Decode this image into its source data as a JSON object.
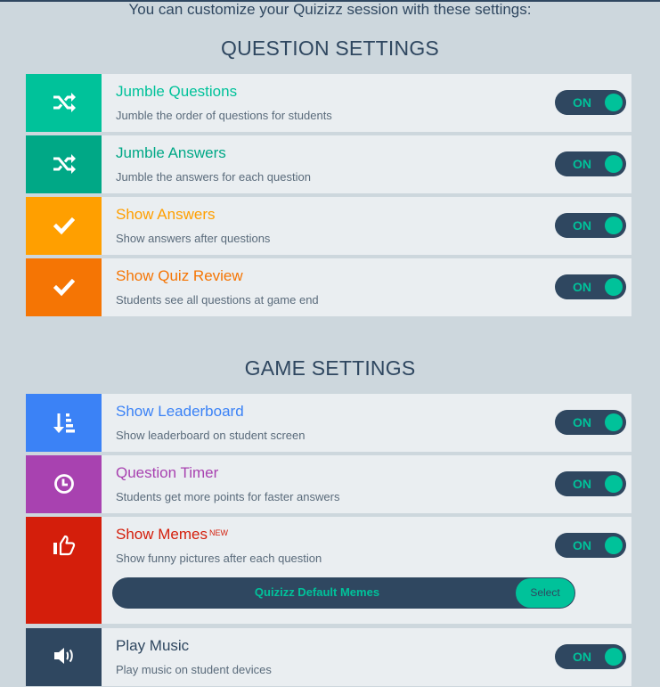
{
  "intro_text": "You can customize your Quizizz session with these settings:",
  "question_settings": {
    "heading": "QUESTION SETTINGS",
    "items": [
      {
        "title": "Jumble Questions",
        "description": "Jumble the order of questions for students",
        "icon": "shuffle-icon",
        "color": "#00c29a",
        "icon_bg": "#00c29a",
        "toggle": "ON"
      },
      {
        "title": "Jumble Answers",
        "description": "Jumble the answers for each question",
        "icon": "shuffle-icon",
        "color": "#00a886",
        "icon_bg": "#00a886",
        "toggle": "ON"
      },
      {
        "title": "Show Answers",
        "description": "Show answers after questions",
        "icon": "check-icon",
        "color": "#ff9f00",
        "icon_bg": "#ff9f00",
        "toggle": "ON"
      },
      {
        "title": "Show Quiz Review",
        "description": "Students see all questions at game end",
        "icon": "check-icon",
        "color": "#f57504",
        "icon_bg": "#f57504",
        "toggle": "ON"
      }
    ]
  },
  "game_settings": {
    "heading": "GAME SETTINGS",
    "items": [
      {
        "title": "Show Leaderboard",
        "description": "Show leaderboard on student screen",
        "icon": "leaderboard-sort-icon",
        "color": "#3b82f6",
        "icon_bg": "#3b82f6",
        "toggle": "ON"
      },
      {
        "title": "Question Timer",
        "description": "Students get more points for faster answers",
        "icon": "clock-icon",
        "color": "#a842b0",
        "icon_bg": "#a842b0",
        "toggle": "ON"
      },
      {
        "title": "Show Memes",
        "badge": "NEW",
        "description": "Show funny pictures after each question",
        "icon": "thumbs-up-icon",
        "color": "#d41e0b",
        "icon_bg": "#d41e0b",
        "toggle": "ON",
        "meme_set": "Quizizz Default Memes",
        "select_label": "Select"
      },
      {
        "title": "Play Music",
        "description": "Play music on student devices",
        "icon": "speaker-icon",
        "color": "#2f4760",
        "icon_bg": "#2f4760",
        "toggle": "ON"
      }
    ]
  }
}
